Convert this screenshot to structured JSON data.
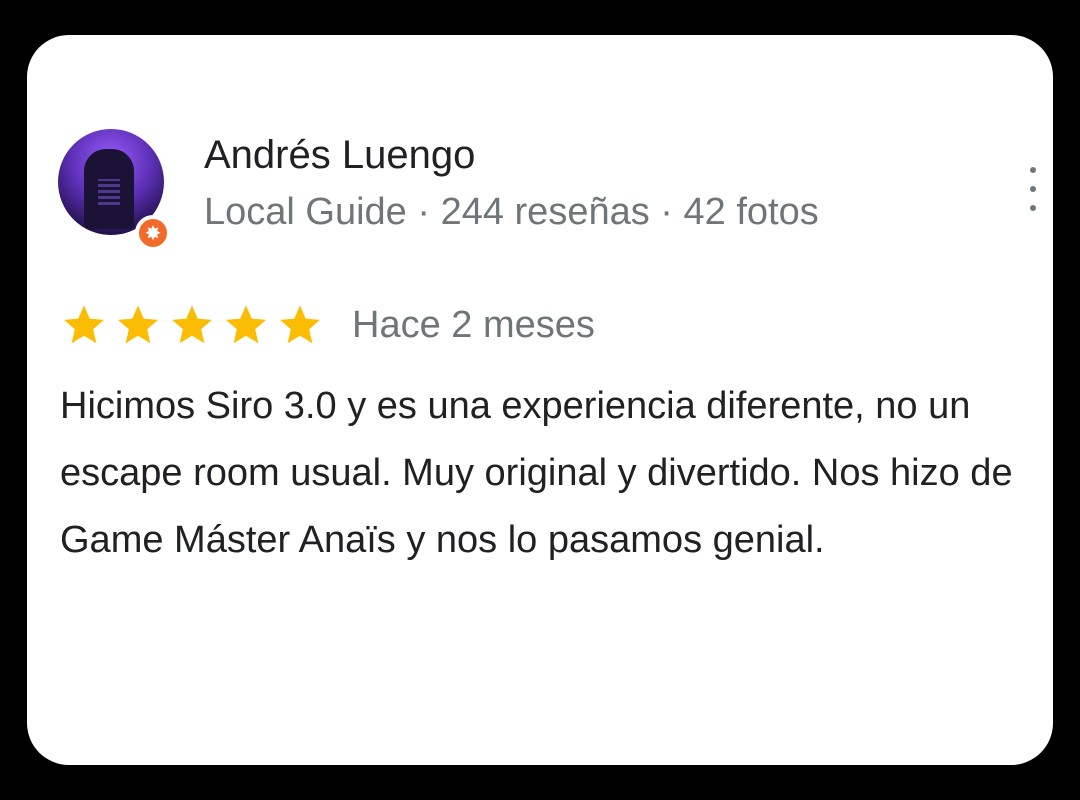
{
  "review": {
    "author_name": "Andrés Luengo",
    "author_meta": "Local Guide · 244 reseñas · 42 fotos",
    "rating": 5,
    "rating_max": 5,
    "date": "Hace 2 meses",
    "text": "Hicimos Siro 3.0 y es una experiencia diferente, no un escape room usual. Muy original y divertido. Nos hizo de Game Máster Anaïs y nos lo pasamos genial."
  },
  "icons": {
    "avatar": "profile-photo",
    "badge": "local-guide-star-icon",
    "menu": "more-vertical-icon",
    "rating": "star-icon"
  },
  "colors": {
    "page_background": "#000000",
    "card_background": "#ffffff",
    "star": "#fbbc04",
    "badge": "#f26b2a",
    "primary_text": "#202124",
    "secondary_text": "#70757a"
  }
}
